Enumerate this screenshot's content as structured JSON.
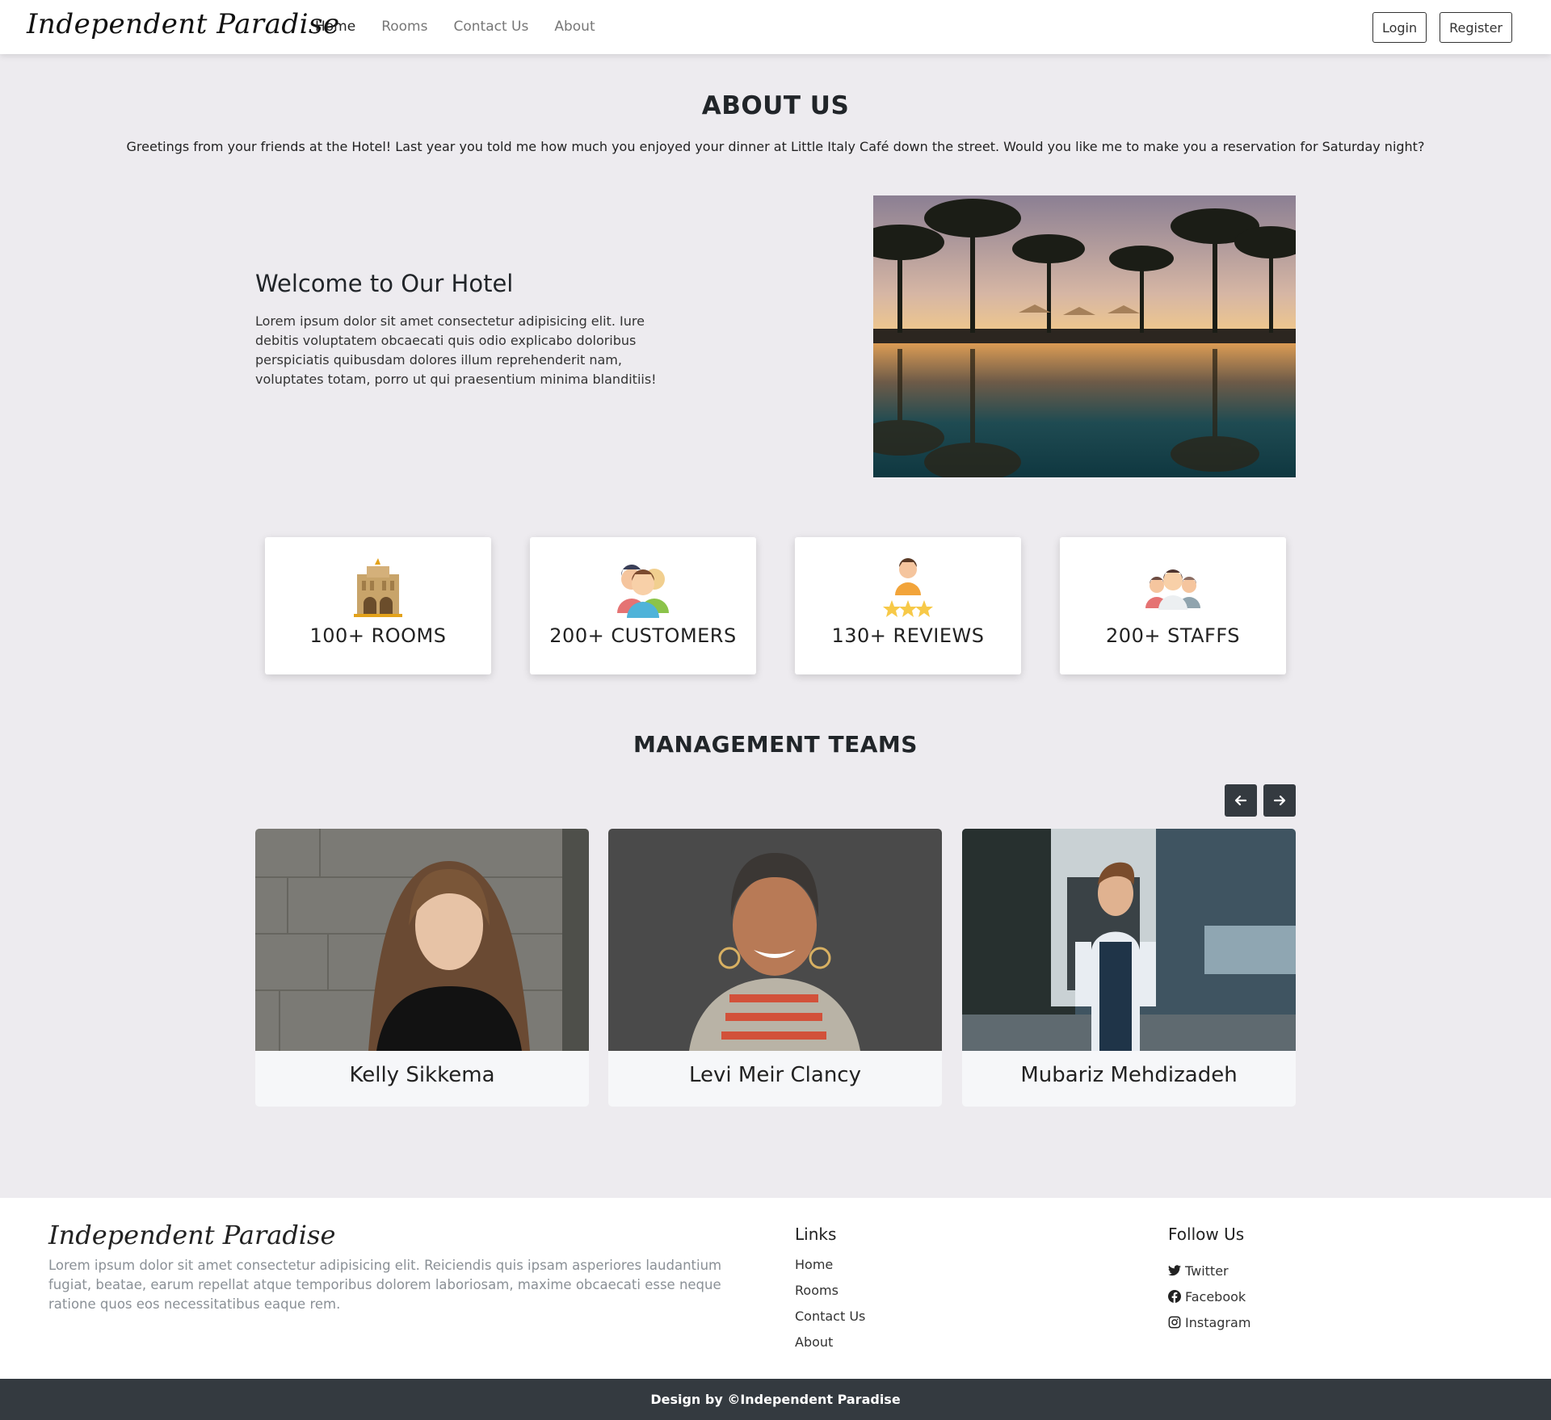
{
  "nav": {
    "brand": "Independent Paradise",
    "links": [
      "Home",
      "Rooms",
      "Contact Us",
      "About"
    ],
    "login": "Login",
    "register": "Register"
  },
  "about": {
    "title": "ABOUT US",
    "text": "Greetings from your friends at the Hotel! Last year you told me how much you enjoyed your dinner at Little Italy Café down the street. Would you like me to make you a reservation for Saturday night?",
    "welcome_title": "Welcome to Our Hotel",
    "welcome_text": "Lorem ipsum dolor sit amet consectetur adipisicing elit. Iure debitis voluptatem obcaecati quis odio explicabo doloribus perspiciatis quibusdam dolores illum reprehenderit nam, voluptates totam, porro ut qui praesentium minima blanditiis!"
  },
  "stats": [
    {
      "label": "100+ ROOMS",
      "icon": "hotel-building-icon"
    },
    {
      "label": "200+ CUSTOMERS",
      "icon": "customers-icon"
    },
    {
      "label": "130+ REVIEWS",
      "icon": "reviews-icon"
    },
    {
      "label": "200+ STAFFS",
      "icon": "staff-icon"
    }
  ],
  "teams": {
    "title": "MANAGEMENT TEAMS",
    "members": [
      "Kelly Sikkema",
      "Levi Meir Clancy",
      "Mubariz Mehdizadeh"
    ]
  },
  "footer": {
    "brand": "Independent Paradise",
    "text": "Lorem ipsum dolor sit amet consectetur adipisicing elit. Reiciendis quis ipsam asperiores laudantium fugiat, beatae, earum repellat atque temporibus dolorem laboriosam, maxime obcaecati esse neque ratione quos eos necessitatibus eaque rem.",
    "links_title": "Links",
    "links": [
      "Home",
      "Rooms",
      "Contact Us",
      "About"
    ],
    "follow_title": "Follow Us",
    "social": [
      "Twitter",
      "Facebook",
      "Instagram"
    ],
    "copyright": "Design by ©Independent Paradise"
  }
}
